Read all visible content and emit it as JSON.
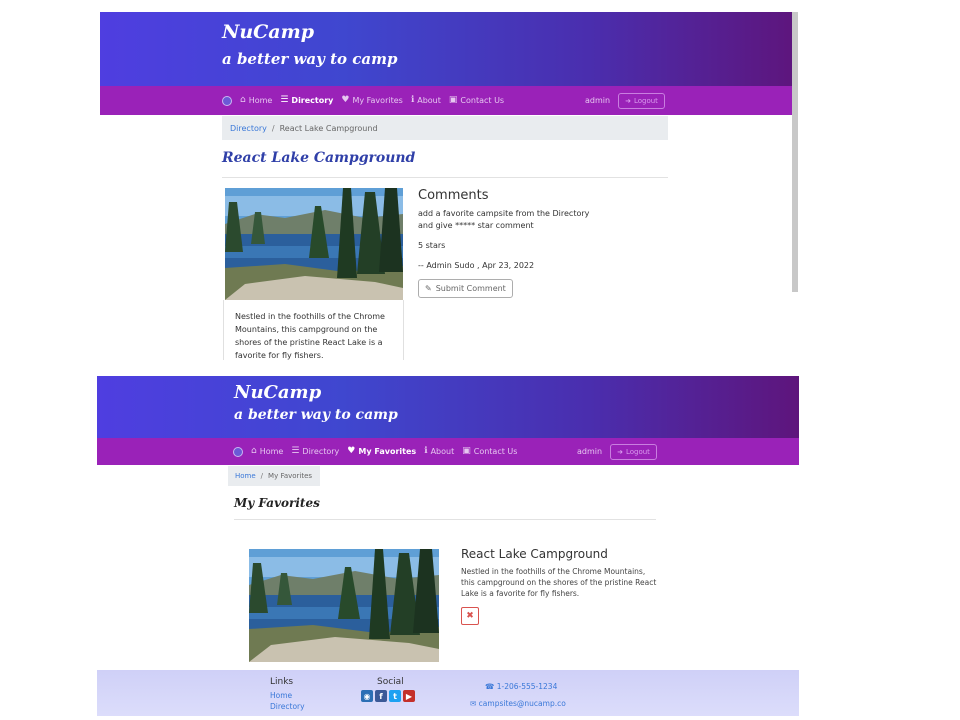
{
  "brand": {
    "title": "NuCamp",
    "subtitle": "a better way to camp"
  },
  "nav": {
    "home": "Home",
    "directory": "Directory",
    "favorites": "My Favorites",
    "about": "About",
    "contact": "Contact Us",
    "admin": "admin",
    "logout": "Logout"
  },
  "detail_view": {
    "breadcrumb": {
      "link": "Directory",
      "separator": "/",
      "current": "React Lake Campground"
    },
    "title": "React Lake Campground",
    "description": "Nestled in the foothills of the Chrome Mountains, this campground on the shores of the pristine React Lake is a favorite for fly fishers.",
    "comments": {
      "heading": "Comments",
      "text": "add a favorite campsite from the Directory and give ***** star comment",
      "rating": "5 stars",
      "author": "-- Admin Sudo , Apr 23, 2022",
      "submit_label": "Submit Comment"
    }
  },
  "favorites_view": {
    "breadcrumb": {
      "link": "Home",
      "separator": "/",
      "current": "My Favorites"
    },
    "title": "My Favorites",
    "item": {
      "name": "React Lake Campground",
      "description": "Nestled in the foothills of the Chrome Mountains, this campground on the shores of the pristine React Lake is a favorite for fly fishers.",
      "remove_symbol": "✖"
    }
  },
  "footer": {
    "links_heading": "Links",
    "links": [
      "Home",
      "Directory"
    ],
    "social_heading": "Social",
    "phone": "1-206-555-1234",
    "email": "campsites@nucamp.co"
  },
  "colors": {
    "header_gradient_start": "#4f3ee0",
    "header_gradient_end": "#5e157c",
    "navbar": "#9a22b8",
    "title_blue": "#2f3fa8",
    "link_blue": "#3a78d8",
    "danger": "#d9534f"
  },
  "icons": [
    "home-icon",
    "list-icon",
    "heart-icon",
    "info-icon",
    "address-card-icon",
    "sign-in-icon",
    "pencil-icon",
    "phone-icon",
    "envelope-icon",
    "instagram-icon",
    "facebook-icon",
    "twitter-icon",
    "youtube-icon"
  ]
}
